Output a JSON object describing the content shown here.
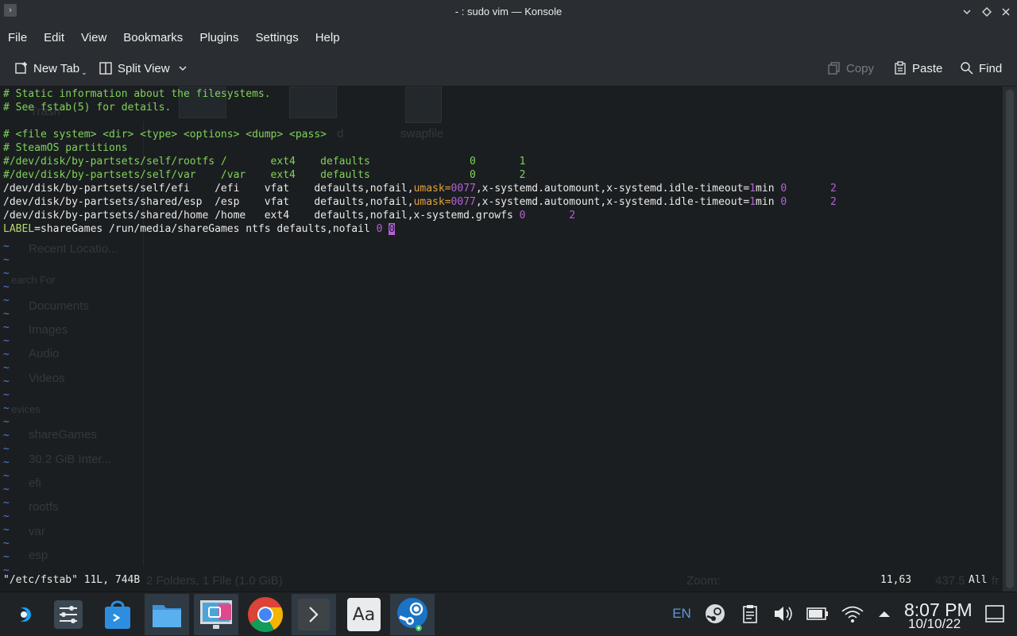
{
  "window": {
    "title": "- : sudo vim — Konsole",
    "app_icon": "terminal-icon"
  },
  "menu": [
    "File",
    "Edit",
    "View",
    "Bookmarks",
    "Plugins",
    "Settings",
    "Help"
  ],
  "toolbar": {
    "new_tab": "New Tab",
    "split_view": "Split View",
    "copy": "Copy",
    "paste": "Paste",
    "find": "Find"
  },
  "background_window": {
    "items": [
      "Trash",
      "swapfile",
      "Recent Locatio...",
      "earch For",
      "Documents",
      "Images",
      "Audio",
      "Videos",
      "evices",
      "shareGames",
      "30.2 GiB Inter...",
      "efi",
      "rootfs",
      "var",
      "esp"
    ],
    "status_left": "2 Folders, 1 File (1.0 GiB)",
    "status_zoom": "Zoom:",
    "status_right": "437.5",
    "status_free": "fr",
    "ghost_mid": "d"
  },
  "terminal": {
    "lines": {
      "l1": "# Static information about the filesystems.",
      "l2": "# See fstab(5) for details.",
      "l3": "# <file system> <dir> <type> <options> <dump> <pass>",
      "l4": "# SteamOS partitions",
      "l5": "#/dev/disk/by-partsets/self/rootfs /       ext4    defaults                0       1",
      "l6": "#/dev/disk/by-partsets/self/var    /var    ext4    defaults                0       2",
      "l7a": "/dev/disk/by-partsets/self/efi    /efi    vfat    defaults,nofail,",
      "l7b": "umask",
      "l7c": "=",
      "l7d": "0077",
      "l7e": ",x-systemd.automount,x-systemd.idle-timeout=",
      "l7f": "1",
      "l7g": "min ",
      "l7h": "0       2",
      "l8a": "/dev/disk/by-partsets/shared/esp  /esp    vfat    defaults,nofail,",
      "l8b": "umask",
      "l8c": "=",
      "l8d": "0077",
      "l8e": ",x-systemd.automount,x-systemd.idle-timeout=",
      "l8f": "1",
      "l8g": "min ",
      "l8h": "0       2",
      "l9a": "/dev/disk/by-partsets/shared/home /home   ext4    defaults,nofail,x-systemd.growfs ",
      "l9b": "0       2",
      "l10a": "LABEL",
      "l10b": "=shareGames /run/media/shareGames ntfs defaults,nofail ",
      "l10c": "0 ",
      "l10d": "0"
    },
    "tilde": "~",
    "status_file": "\"/etc/fstab\" 11L, 744B",
    "status_pos": "11,63",
    "status_all": "All"
  },
  "taskbar": {
    "apps": [
      "app-launcher-icon",
      "system-settings-icon",
      "discover-store-icon",
      "dolphin-files-icon",
      "spectacle-screenshot-icon",
      "chrome-browser-icon",
      "konsole-terminal-icon",
      "font-viewer-icon",
      "steam-icon"
    ],
    "font_viewer_label": "Aa",
    "lang": "EN",
    "time": "8:07 PM",
    "date": "10/10/22"
  },
  "colors": {
    "comment": "#7fd35a",
    "number": "#b461d6",
    "keyword": "#e0a23a",
    "tilde": "#4d7bd8"
  }
}
